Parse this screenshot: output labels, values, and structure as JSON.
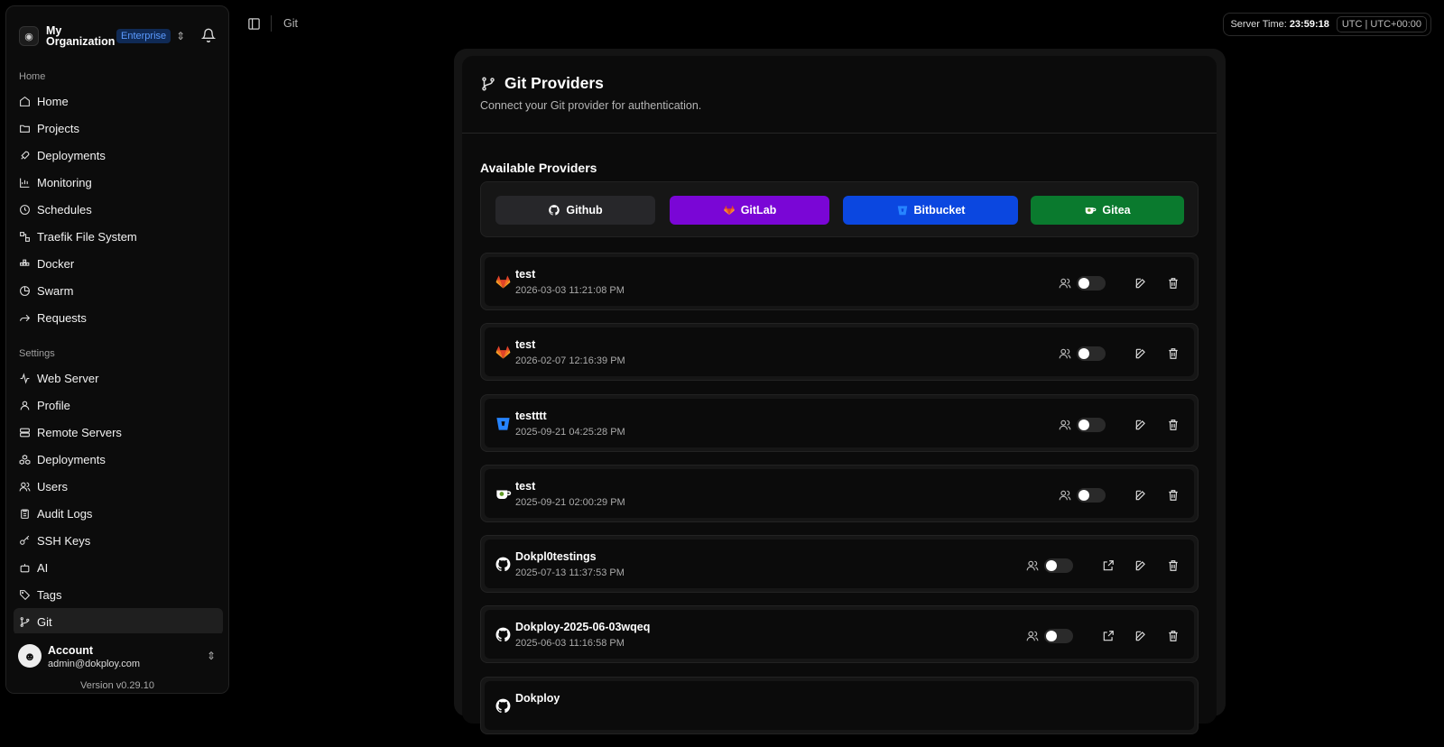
{
  "org": {
    "name": "My Organization",
    "plan": "Enterprise"
  },
  "sidebar": {
    "home_label": "Home",
    "home_items": [
      {
        "label": "Home",
        "icon": "home-icon"
      },
      {
        "label": "Projects",
        "icon": "folder-icon"
      },
      {
        "label": "Deployments",
        "icon": "rocket-icon"
      },
      {
        "label": "Monitoring",
        "icon": "chart-icon"
      },
      {
        "label": "Schedules",
        "icon": "clock-icon"
      },
      {
        "label": "Traefik File System",
        "icon": "file-system-icon"
      },
      {
        "label": "Docker",
        "icon": "docker-icon"
      },
      {
        "label": "Swarm",
        "icon": "pie-icon"
      },
      {
        "label": "Requests",
        "icon": "forward-icon"
      }
    ],
    "settings_label": "Settings",
    "settings_items": [
      {
        "label": "Web Server",
        "icon": "activity-icon"
      },
      {
        "label": "Profile",
        "icon": "user-icon"
      },
      {
        "label": "Remote Servers",
        "icon": "server-icon"
      },
      {
        "label": "Deployments",
        "icon": "boxes-icon"
      },
      {
        "label": "Users",
        "icon": "users-icon"
      },
      {
        "label": "Audit Logs",
        "icon": "clipboard-icon"
      },
      {
        "label": "SSH Keys",
        "icon": "key-icon"
      },
      {
        "label": "AI",
        "icon": "bot-icon"
      },
      {
        "label": "Tags",
        "icon": "tags-icon"
      },
      {
        "label": "Git",
        "icon": "git-icon"
      }
    ]
  },
  "account": {
    "name": "Account",
    "email": "admin@dokploy.com",
    "version": "Version v0.29.10"
  },
  "breadcrumb": "Git",
  "server_time": {
    "label": "Server Time:",
    "time": "23:59:18",
    "tz": "UTC | UTC+00:00"
  },
  "panel": {
    "title": "Git Providers",
    "subtitle": "Connect your Git provider for authentication.",
    "available_label": "Available Providers",
    "provider_buttons": [
      {
        "label": "Github",
        "color": "#27272a"
      },
      {
        "label": "GitLab",
        "color": "#7a06d6"
      },
      {
        "label": "Bitbucket",
        "color": "#0b47e0"
      },
      {
        "label": "Gitea",
        "color": "#0a7a2e"
      }
    ],
    "providers": [
      {
        "name": "test",
        "date": "2026-03-03 11:21:08 PM",
        "type": "gitlab"
      },
      {
        "name": "test",
        "date": "2026-02-07 12:16:39 PM",
        "type": "gitlab"
      },
      {
        "name": "testttt",
        "date": "2025-09-21 04:25:28 PM",
        "type": "bitbucket"
      },
      {
        "name": "test",
        "date": "2025-09-21 02:00:29 PM",
        "type": "gitea"
      },
      {
        "name": "Dokpl0testings",
        "date": "2025-07-13 11:37:53 PM",
        "type": "github"
      },
      {
        "name": "Dokploy-2025-06-03wqeq",
        "date": "2025-06-03 11:16:58 PM",
        "type": "github"
      },
      {
        "name": "Dokploy",
        "date": "",
        "type": "github"
      }
    ]
  }
}
